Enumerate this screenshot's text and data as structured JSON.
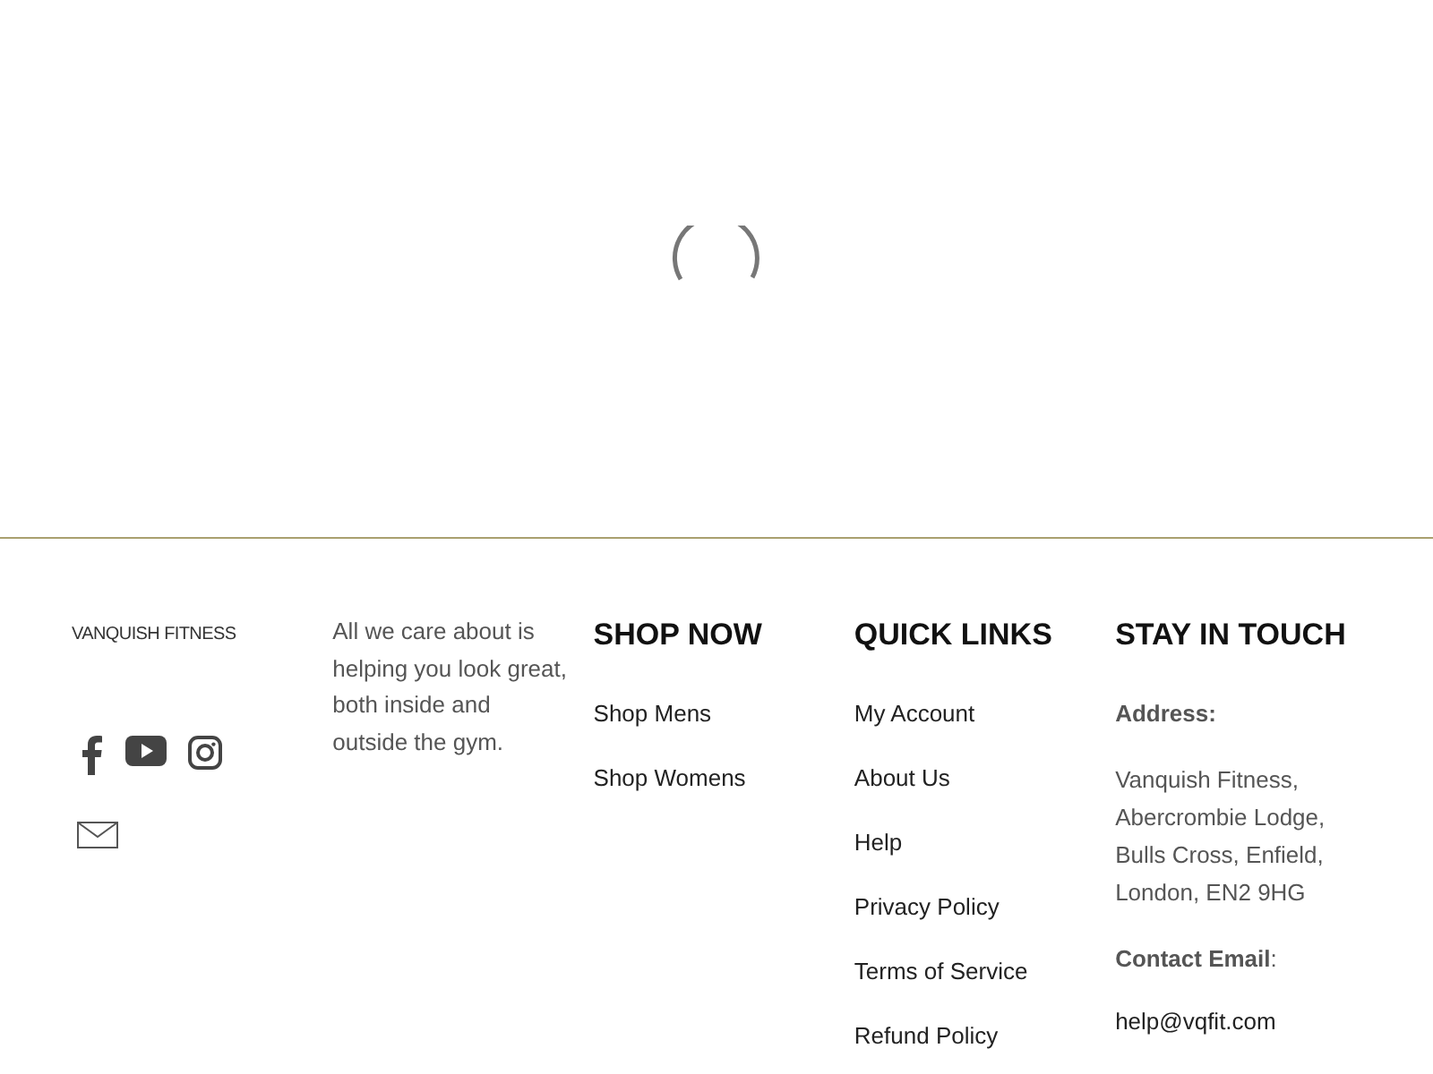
{
  "loading": {
    "kind": "spinner"
  },
  "footer": {
    "logo": "VANQUISH FITNESS",
    "socials": [
      {
        "kind": "facebook"
      },
      {
        "kind": "youtube"
      },
      {
        "kind": "instagram"
      }
    ],
    "newsletter": {
      "kind": "mail"
    },
    "about": "All we care about is helping you look great, both inside and outside the gym.",
    "columns": [
      {
        "heading": "SHOP NOW",
        "links": [
          "Shop Mens",
          "Shop Womens"
        ]
      },
      {
        "heading": "QUICK LINKS",
        "links": [
          "My Account",
          "About Us",
          "Help",
          "Privacy Policy",
          "Terms of Service",
          "Refund Policy"
        ]
      }
    ],
    "contact": {
      "heading": "STAY IN TOUCH",
      "address_label": "Address:",
      "address": "Vanquish Fitness, Abercrombie Lodge, Bulls Cross, Enfield, London, EN2 9HG",
      "email_label": "**Contact Email**:",
      "email": "help@vqfit.com"
    }
  }
}
